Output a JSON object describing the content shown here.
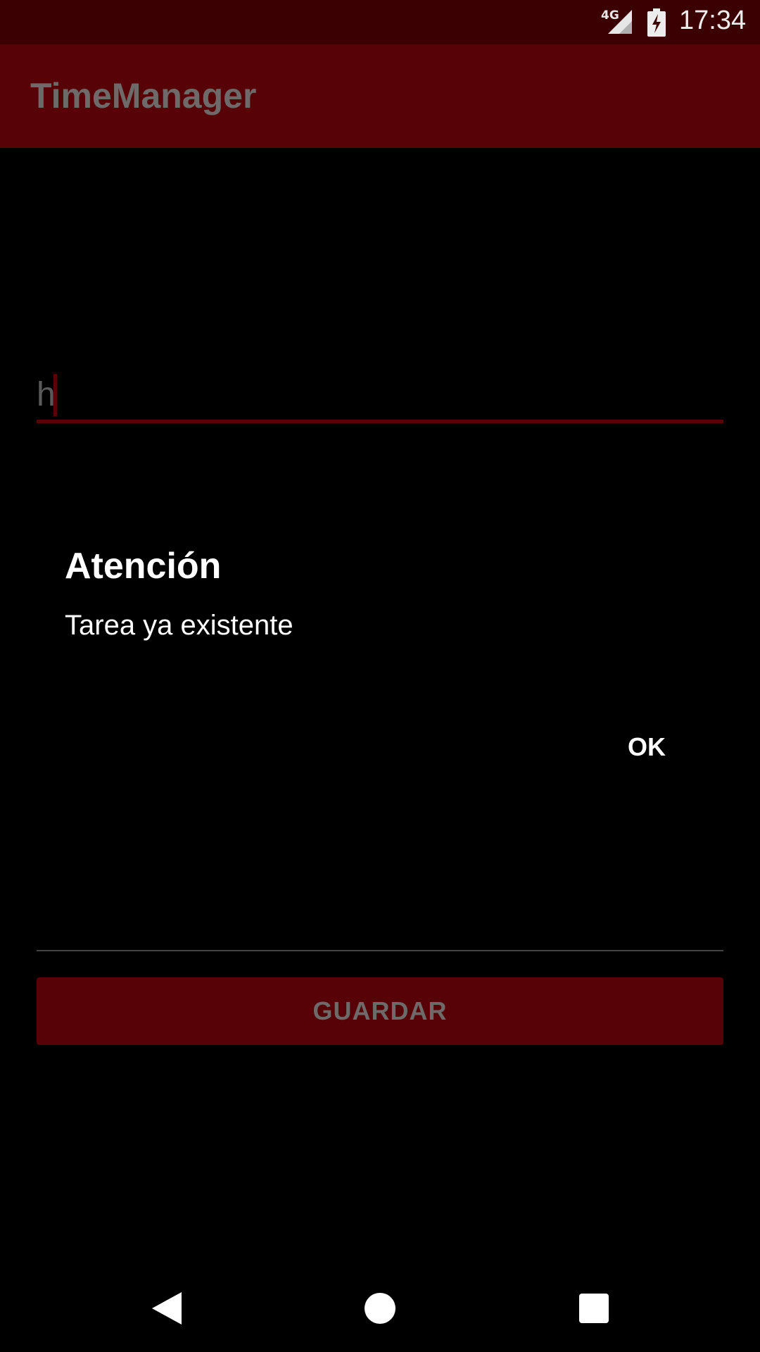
{
  "status_bar": {
    "network": "4G",
    "time": "17:34",
    "icons": [
      "signal-icon",
      "battery-charging-icon"
    ]
  },
  "app_bar": {
    "title": "TimeManager"
  },
  "task_input": {
    "value": "h"
  },
  "dialog": {
    "title": "Atención",
    "message": "Tarea ya existente",
    "ok_label": "OK"
  },
  "save_button": {
    "label": "GUARDAR"
  },
  "nav_bar": {
    "icons": [
      "back-icon",
      "home-icon",
      "recent-apps-icon"
    ]
  },
  "colors": {
    "status_bar": "#3b0002",
    "app_bar": "#560206",
    "accent": "#5a0206",
    "background": "#000000"
  }
}
